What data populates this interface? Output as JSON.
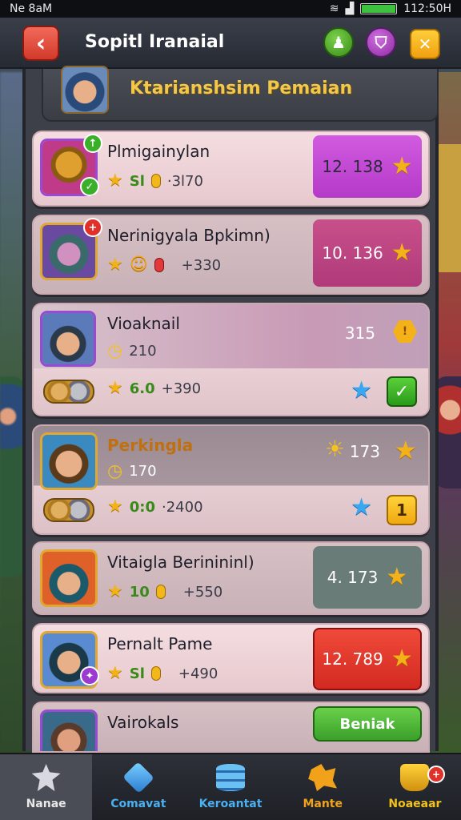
{
  "status_bar": {
    "left": "Ne 8aM",
    "right": "112:50H"
  },
  "header": {
    "back_icon": "back-arrow-icon",
    "title": "Sopitl Iranaial",
    "buttons": [
      {
        "icon": "profile-icon",
        "color": "#5ab02a"
      },
      {
        "icon": "shield-icon",
        "color": "#b040c8"
      },
      {
        "icon": "close-icon",
        "color": "#f2b21a"
      }
    ]
  },
  "panel": {
    "title": "Ktarianshsim Pemaian"
  },
  "cards": [
    {
      "name": "Plmigainylan",
      "stat_a": "Sl",
      "stat_b": "·3l70",
      "price": "12. 138"
    },
    {
      "name": "Nerinigyala Bpkimn)",
      "stat_b": "+330",
      "price": "10. 136"
    },
    {
      "name": "Vioaknail",
      "stat_coin": "210",
      "value": "315",
      "sub_a": "6.0",
      "sub_b": "+390"
    },
    {
      "name": "Perkingla",
      "stat_coin": "170",
      "value": "173",
      "sub_a": "0:0",
      "sub_b": "·2400",
      "btn": "1"
    },
    {
      "name": "Vitaigla Berinininl)",
      "stat_a": "10",
      "stat_b": "+550",
      "price": "4. 173"
    },
    {
      "name": "Pernalt Pame",
      "stat_a": "Sl",
      "stat_b": "+490",
      "price": "12. 789"
    },
    {
      "name": "Vairokals",
      "btn": "Beniak"
    }
  ],
  "bottom_nav": [
    {
      "label": "Nanae",
      "icon": "star-badge-icon",
      "color": "#e8e8e8",
      "active": true
    },
    {
      "label": "Comavat",
      "icon": "cube-icon",
      "color": "#4ab0f0"
    },
    {
      "label": "Keroantat",
      "icon": "database-icon",
      "color": "#4ab0f0"
    },
    {
      "label": "Mante",
      "icon": "map-icon",
      "color": "#f2a21a"
    },
    {
      "label": "Noaeaar",
      "icon": "trophy-icon",
      "color": "#f2c21a",
      "badge": "+"
    }
  ]
}
